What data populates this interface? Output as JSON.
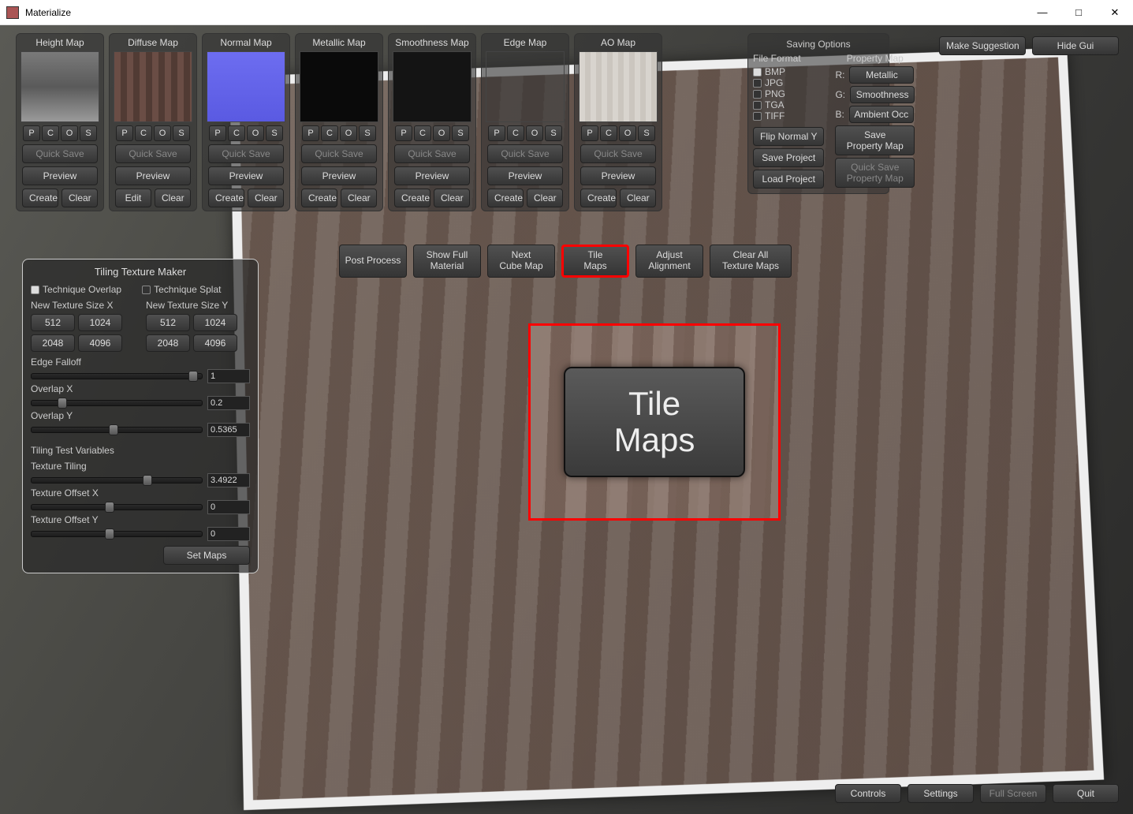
{
  "window": {
    "title": "Materialize"
  },
  "top_right": {
    "suggestion": "Make Suggestion",
    "hide_gui": "Hide Gui"
  },
  "maps": [
    {
      "title": "Height Map",
      "bg": "linear-gradient(#7a7a7a,#5a5a5a,#9a9a9a)",
      "quick": "Quick Save",
      "preview": "Preview",
      "create": "Create",
      "clear": "Clear",
      "has_edit": false
    },
    {
      "title": "Diffuse Map",
      "bg": "repeating-linear-gradient(90deg,#6a4d45 0 8px,#513b34 8px 16px)",
      "quick": "Quick Save",
      "preview": "Preview",
      "create": "Edit",
      "clear": "Clear",
      "has_edit": true
    },
    {
      "title": "Normal Map",
      "bg": "linear-gradient(#6d6df0,#5a5ae2)",
      "quick": "Quick Save",
      "preview": "Preview",
      "create": "Create",
      "clear": "Clear",
      "has_edit": false
    },
    {
      "title": "Metallic Map",
      "bg": "#0a0a0a",
      "quick": "Quick Save",
      "preview": "Preview",
      "create": "Create",
      "clear": "Clear",
      "has_edit": false
    },
    {
      "title": "Smoothness Map",
      "bg": "#141414",
      "quick": "Quick Save",
      "preview": "Preview",
      "create": "Create",
      "clear": "Clear",
      "has_edit": false
    },
    {
      "title": "Edge Map",
      "bg": "transparent",
      "quick": "Quick Save",
      "preview": "Preview",
      "create": "Create",
      "clear": "Clear",
      "transparent": true,
      "has_edit": false
    },
    {
      "title": "AO Map",
      "bg": "repeating-linear-gradient(90deg,#d8d4ce 0 7px,#cbc6bf 7px 14px)",
      "quick": "Quick Save",
      "preview": "Preview",
      "create": "Create",
      "clear": "Clear",
      "has_edit": false
    }
  ],
  "pcos": {
    "p": "P",
    "c": "C",
    "o": "O",
    "s": "S"
  },
  "saving": {
    "title": "Saving Options",
    "file_format": "File Format",
    "formats": [
      "BMP",
      "JPG",
      "PNG",
      "TGA",
      "TIFF"
    ],
    "selected_format": "BMP",
    "flip": "Flip Normal Y",
    "save_proj": "Save Project",
    "load_proj": "Load Project",
    "property_map": "Property Map",
    "channels": {
      "R": "Metallic",
      "G": "Smoothness",
      "B": "Ambient Occ"
    },
    "save_pm": "Save\nProperty Map",
    "quick_pm": "Quick Save\nProperty Map"
  },
  "actions": {
    "post_process": "Post Process",
    "show_full": "Show Full\nMaterial",
    "next_cube": "Next\nCube Map",
    "tile_maps": "Tile\nMaps",
    "adjust_align": "Adjust\nAlignment",
    "clear_all": "Clear All\nTexture Maps"
  },
  "tiling": {
    "title": "Tiling Texture Maker",
    "tech_overlap": "Technique Overlap",
    "tech_splat": "Technique Splat",
    "tech_selected": "overlap",
    "size_x_label": "New Texture Size X",
    "size_y_label": "New Texture Size Y",
    "sizes": [
      "512",
      "1024",
      "2048",
      "4096"
    ],
    "sliders": {
      "edge_falloff": {
        "label": "Edge Falloff",
        "value": "1",
        "pct": 95
      },
      "overlap_x": {
        "label": "Overlap X",
        "value": "0.2",
        "pct": 18
      },
      "overlap_y": {
        "label": "Overlap Y",
        "value": "0.5365",
        "pct": 48
      },
      "texture_tiling": {
        "label": "Texture Tiling",
        "value": "3.4922",
        "pct": 68
      },
      "texture_off_x": {
        "label": "Texture Offset X",
        "value": "0",
        "pct": 46
      },
      "texture_off_y": {
        "label": "Texture Offset Y",
        "value": "0",
        "pct": 46
      }
    },
    "tiling_vars": "Tiling Test Variables",
    "set_maps": "Set Maps"
  },
  "callout": {
    "line1": "Tile",
    "line2": "Maps"
  },
  "bottom": {
    "controls": "Controls",
    "settings": "Settings",
    "fullscreen": "Full Screen",
    "quit": "Quit"
  }
}
